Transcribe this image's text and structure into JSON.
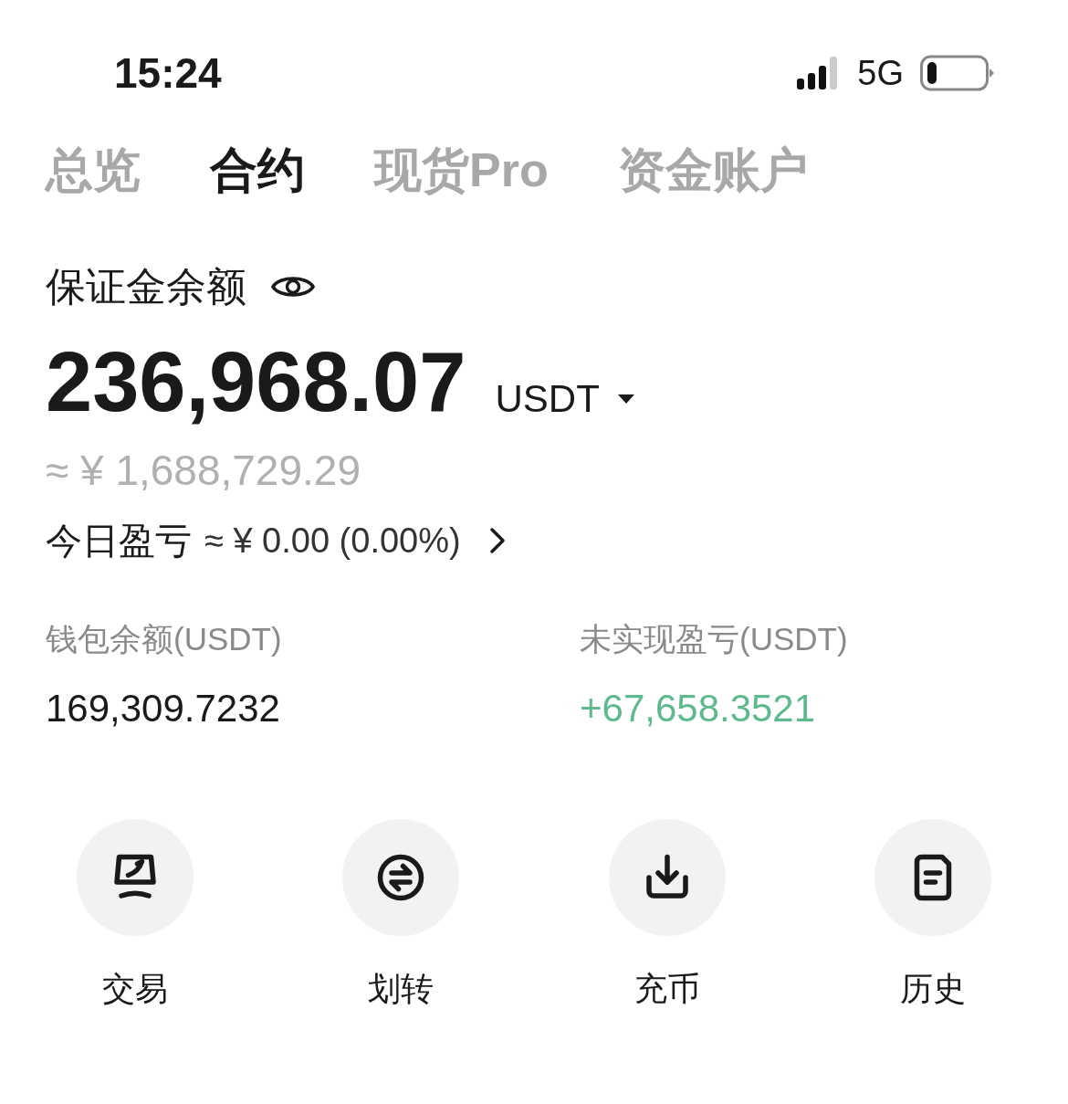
{
  "status_bar": {
    "time": "15:24",
    "network": "5G"
  },
  "tabs": [
    {
      "label": "总览",
      "selected": false
    },
    {
      "label": "合约",
      "selected": true
    },
    {
      "label": "现货Pro",
      "selected": false
    },
    {
      "label": "资金账户",
      "selected": false
    }
  ],
  "balance": {
    "label": "保证金余额",
    "amount": "236,968.07",
    "currency": "USDT",
    "approx": "≈ ¥ 1,688,729.29"
  },
  "today_pnl": {
    "label": "今日盈亏",
    "value": "≈ ¥ 0.00 (0.00%)"
  },
  "stats": [
    {
      "label": "钱包余额(USDT)",
      "value": "169,309.7232",
      "kind": "neutral"
    },
    {
      "label": "未实现盈亏(USDT)",
      "value": "+67,658.3521",
      "kind": "positive"
    }
  ],
  "actions": [
    {
      "label": "交易",
      "kind": "trade"
    },
    {
      "label": "划转",
      "kind": "transfer"
    },
    {
      "label": "充币",
      "kind": "deposit"
    },
    {
      "label": "历史",
      "kind": "history"
    }
  ]
}
